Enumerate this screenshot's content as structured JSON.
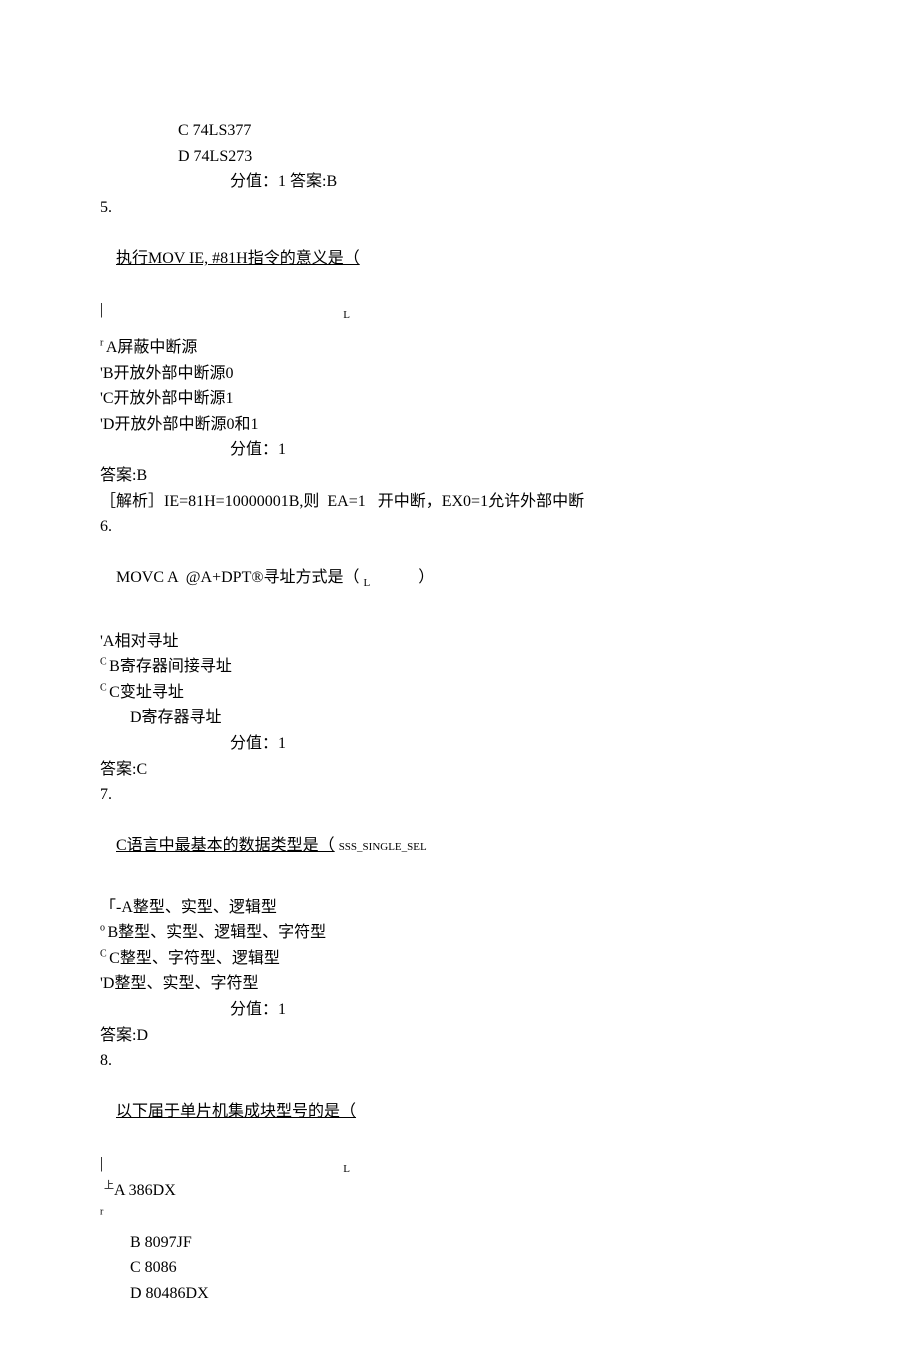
{
  "q4": {
    "option_c": "C 74LS377",
    "option_d": "D 74LS273",
    "score_answer": "分值：1 答案:B"
  },
  "q5": {
    "number": "5.",
    "stem": "执行MOV IE, #81H指令的意义是（",
    "sub_marker": "L",
    "prefix_a": "r ",
    "option_a": "A屏蔽中断源",
    "option_b": "'B开放外部中断源0",
    "option_c": "'C开放外部中断源1",
    "option_d": "'D开放外部中断源0和1",
    "score": "分值：1",
    "answer": "答案:B",
    "analysis": "［解析］IE=81H=10000001B,则  EA=1   开中断，EX0=1允许外部中断"
  },
  "q6": {
    "number": "6.",
    "stem_a": "MOVC A  @A+DPT®寻址方式是（",
    "stem_b": "L",
    "stem_c": "）",
    "option_a": "'A相对寻址",
    "circ": "C ",
    "option_b": "B寄存器间接寻址",
    "option_c": "C变址寻址",
    "option_d": "D寄存器寻址",
    "score": "分值：1",
    "answer": "答案:C"
  },
  "q7": {
    "number": "7.",
    "stem": "C语言中最基本的数据类型是（",
    "stem_tag": "SSS_SINGLE_SEL",
    "option_a": "「-A整型、实型、逻辑型",
    "circ_o": "o ",
    "option_b": "B整型、实型、逻辑型、字符型",
    "circ_c": "C ",
    "option_c": "C整型、字符型、逻辑型",
    "option_d": "'D整型、实型、字符型",
    "score": "分值：1",
    "answer": "答案:D"
  },
  "q8": {
    "number": "8.",
    "stem": "以下届于单片机集成块型号的是（",
    "sub_marker": "L",
    "pre_a": "上",
    "option_a": "A 386DX",
    "pre_b": "r",
    "option_b": "B 8097JF",
    "option_c": "C 8086",
    "option_d": "D 80486DX"
  }
}
